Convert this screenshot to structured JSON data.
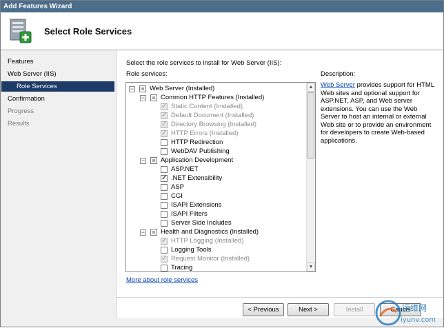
{
  "window": {
    "title": "Add Features Wizard"
  },
  "header": {
    "title": "Select Role Services"
  },
  "nav": {
    "items": [
      {
        "label": "Features",
        "state": "normal"
      },
      {
        "label": "Web Server (IIS)",
        "state": "normal"
      },
      {
        "label": "Role Services",
        "state": "selected"
      },
      {
        "label": "Confirmation",
        "state": "normal"
      },
      {
        "label": "Progress",
        "state": "disabled"
      },
      {
        "label": "Results",
        "state": "disabled"
      }
    ]
  },
  "main": {
    "instruction": "Select the role services to install for Web Server (IIS):",
    "role_services_label": "Role services:",
    "more_link": "More about role services"
  },
  "tree": [
    {
      "label": "Web Server  (Installed)",
      "expander": "minus",
      "check": "partial",
      "grey": false
    },
    {
      "label": "Common HTTP Features  (Installed)",
      "expander": "minus",
      "check": "partial",
      "grey": false
    },
    {
      "label": "Static Content  (Installed)",
      "check": "checked",
      "grey": true
    },
    {
      "label": "Default Document  (Installed)",
      "check": "checked",
      "grey": true
    },
    {
      "label": "Directory Browsing  (Installed)",
      "check": "checked",
      "grey": true
    },
    {
      "label": "HTTP Errors  (Installed)",
      "check": "checked",
      "grey": true
    },
    {
      "label": "HTTP Redirection",
      "check": "unchecked",
      "grey": false
    },
    {
      "label": "WebDAV Publishing",
      "check": "unchecked",
      "grey": false
    },
    {
      "label": "Application Development",
      "expander": "minus",
      "check": "partial",
      "grey": false
    },
    {
      "label": "ASP.NET",
      "check": "unchecked",
      "grey": false
    },
    {
      "label": ".NET Extensibility",
      "check": "checked",
      "grey": false
    },
    {
      "label": "ASP",
      "check": "unchecked",
      "grey": false
    },
    {
      "label": "CGI",
      "check": "unchecked",
      "grey": false
    },
    {
      "label": "ISAPI Extensions",
      "check": "unchecked",
      "grey": false
    },
    {
      "label": "ISAPI Filters",
      "check": "unchecked",
      "grey": false
    },
    {
      "label": "Server Side Includes",
      "check": "unchecked",
      "grey": false
    },
    {
      "label": "Health and Diagnostics  (Installed)",
      "expander": "minus",
      "check": "partial",
      "grey": false
    },
    {
      "label": "HTTP Logging  (Installed)",
      "check": "checked",
      "grey": true
    },
    {
      "label": "Logging Tools",
      "check": "unchecked",
      "grey": false
    },
    {
      "label": "Request Monitor  (Installed)",
      "check": "checked",
      "grey": true
    },
    {
      "label": "Tracing",
      "check": "unchecked",
      "grey": false
    }
  ],
  "description": {
    "title": "Description:",
    "link_text": "Web Server",
    "body": " provides support for HTML Web sites and optional support for ASP.NET, ASP, and Web server extensions. You can use the Web Server to host an internal or external Web site or to provide an environment for developers to create Web-based applications."
  },
  "buttons": {
    "previous": "< Previous",
    "next": "Next >",
    "install": "Install",
    "cancel": "Cancel"
  },
  "watermark": {
    "text_cn": "运维网",
    "text_url": "iyunv.com"
  },
  "colors": {
    "selected_nav": "#1d3b66",
    "link": "#0645ad",
    "titlebar": "#4a6e8c"
  }
}
